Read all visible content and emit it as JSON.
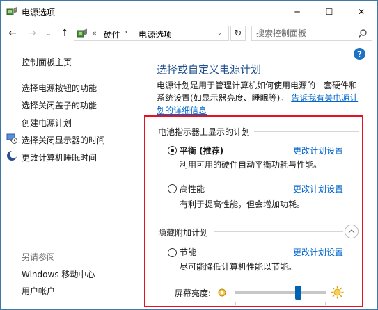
{
  "window": {
    "title": "电源选项",
    "minimize": "─",
    "maximize": "☐",
    "close": "✕"
  },
  "nav": {
    "back": "←",
    "forward": "→",
    "dropdown": "⌄",
    "up": "↑",
    "chevron": "«",
    "breadcrumbs": [
      "硬件",
      "电源选项"
    ],
    "separator": "›",
    "refresh": "↻",
    "search_placeholder": "搜索控制面板"
  },
  "sidebar": {
    "items": [
      {
        "label": "控制面板主页"
      },
      {
        "label": "选择电源按钮的功能"
      },
      {
        "label": "选择关闭盖子的功能"
      },
      {
        "label": "创建电源计划"
      },
      {
        "label": "选择关闭显示器的时间",
        "icon": "display-clock-icon"
      },
      {
        "label": "更改计算机睡眠时间",
        "icon": "moon-sleep-icon"
      }
    ],
    "see_also_title": "另请参阅",
    "see_also": [
      {
        "label": "Windows 移动中心"
      },
      {
        "label": "用户帐户"
      }
    ]
  },
  "main": {
    "help": "?",
    "title": "选择或自定义电源计划",
    "description": "电源计划是用于管理计算机如何使用电源的一套硬件和系统设置(如显示器亮度、睡眠等)。",
    "description_link": "告诉我有关电源计划的详细信息",
    "battery_group_title": "电池指示器上显示的计划",
    "hidden_group_title": "隐藏附加计划",
    "change_settings_label": "更改计划设置",
    "plans": [
      {
        "name": "平衡 (推荐)",
        "description": "利用可用的硬件自动平衡功耗与性能。",
        "selected": true
      },
      {
        "name": "高性能",
        "description": "有利于提高性能，但会增加功耗。",
        "selected": false
      },
      {
        "name": "节能",
        "description": "尽可能降低计算机性能以节能。",
        "selected": false
      }
    ],
    "brightness_label": "屏幕亮度:",
    "brightness_level": 0.71,
    "accent_color": "#0063b1",
    "highlight_border_color": "#e81123"
  }
}
